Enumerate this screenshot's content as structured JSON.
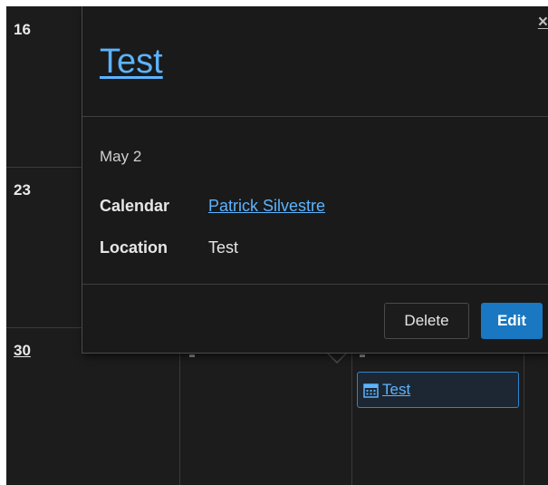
{
  "calendar": {
    "days": [
      {
        "number": "16"
      },
      {
        "number": "23"
      },
      {
        "number": "30"
      }
    ],
    "event_chip": {
      "label": "Test",
      "icon": "calendar-icon"
    }
  },
  "popup": {
    "title": "Test",
    "close_label": "×",
    "date": "May 2",
    "calendar_label": "Calendar",
    "calendar_value": "Patrick Silvestre",
    "location_label": "Location",
    "location_value": "Test",
    "delete_label": "Delete",
    "edit_label": "Edit"
  },
  "colors": {
    "background": "#1c1c1c",
    "link": "#5cb3ff",
    "primary_button": "#1a78c2",
    "grid_line": "#3a3a3a"
  }
}
